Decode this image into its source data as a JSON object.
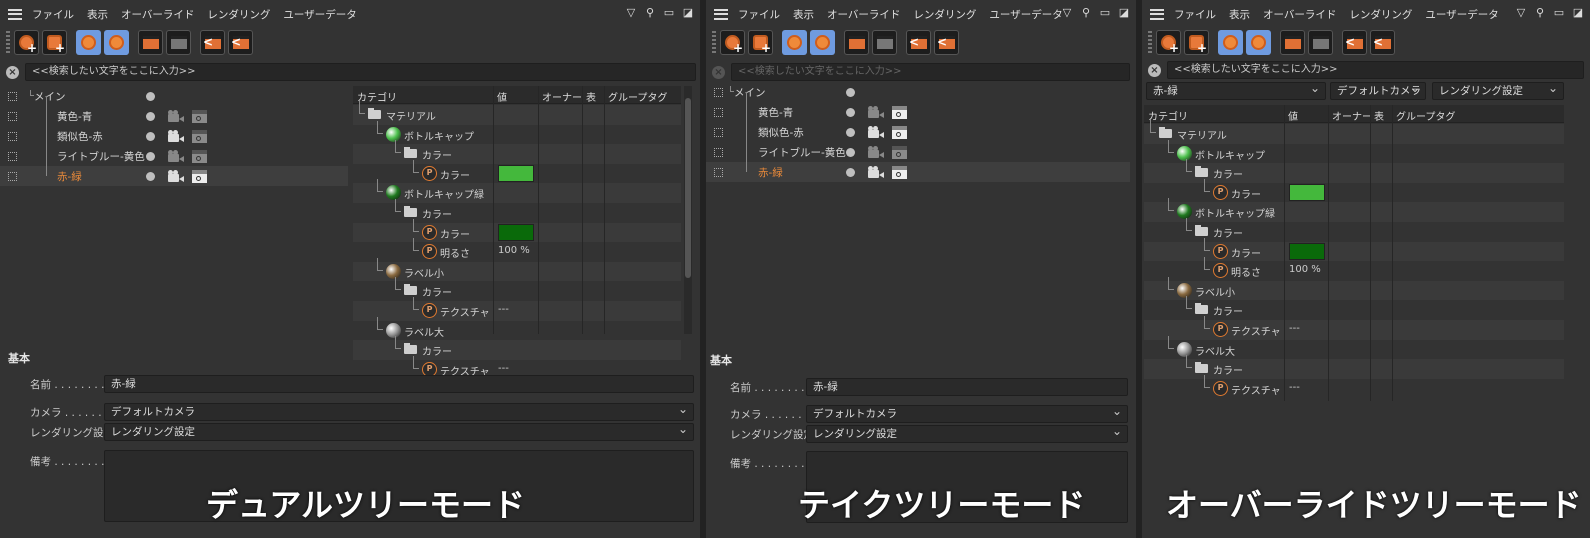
{
  "menu": {
    "items": [
      "ファイル",
      "表示",
      "オーバーライド",
      "レンダリング",
      "ユーザーデータ"
    ]
  },
  "search": {
    "placeholder": "<<検索したい文字をここに入力>>"
  },
  "takes": [
    {
      "name": "メイン",
      "indent": 0
    },
    {
      "name": "黄色-青",
      "indent": 1
    },
    {
      "name": "類似色-赤",
      "indent": 1
    },
    {
      "name": "ライトブルー-黄色",
      "indent": 1
    },
    {
      "name": "赤-緑",
      "indent": 1,
      "active": true
    }
  ],
  "grid": {
    "headers": [
      "カテゴリ",
      "値",
      "オーナー",
      "表",
      "グループタグ"
    ],
    "rows": [
      {
        "name": "マテリアル",
        "level": 0,
        "icon": "folder-icon"
      },
      {
        "name": "ボトルキャップ",
        "level": 1,
        "icon": "material-ball-icon",
        "ball": "#4cc04c"
      },
      {
        "name": "カラー",
        "level": 2,
        "icon": "folder-icon"
      },
      {
        "name": "カラー",
        "level": 3,
        "icon": "param-icon",
        "swatch": "#44b83c"
      },
      {
        "name": "ボトルキャップ緑",
        "level": 1,
        "icon": "material-ball-icon",
        "ball": "#1f7a1f"
      },
      {
        "name": "カラー",
        "level": 2,
        "icon": "folder-icon"
      },
      {
        "name": "カラー",
        "level": 3,
        "icon": "param-icon",
        "swatch": "#0a6a0a"
      },
      {
        "name": "明るさ",
        "level": 3,
        "icon": "param-icon",
        "value": "100 %"
      },
      {
        "name": "ラベル小",
        "level": 1,
        "icon": "label-ball-icon",
        "ball": "#8a6a40"
      },
      {
        "name": "カラー",
        "level": 2,
        "icon": "folder-icon"
      },
      {
        "name": "テクスチャ",
        "level": 3,
        "icon": "param-icon",
        "value": "---"
      },
      {
        "name": "ラベル大",
        "level": 1,
        "icon": "label-ball-icon",
        "ball": "#9a9a9a"
      },
      {
        "name": "カラー",
        "level": 2,
        "icon": "folder-icon"
      },
      {
        "name": "テクスチャ",
        "level": 3,
        "icon": "param-icon",
        "value": "---"
      }
    ]
  },
  "attributes": {
    "section": "基本",
    "name_label": "名前 . . . . . . . .",
    "name_value": "赤-緑",
    "camera_label": "カメラ . . . . . . . .",
    "camera_value": "デフォルトカメラ",
    "render_label": "レンダリング設定",
    "render_value": "レンダリング設定",
    "memo_label": "備考 . . . . . . . ."
  },
  "override_bar": {
    "take": "赤-緑",
    "camera": "デフォルトカメラ",
    "render": "レンダリング設定"
  },
  "captions": {
    "dual": "デュアルツリーモード",
    "take": "テイクツリーモード",
    "override": "オーバーライドツリーモード"
  },
  "colors": {
    "active_take": "#e8893a",
    "panel": "#333333",
    "header": "#2b2b2b"
  }
}
